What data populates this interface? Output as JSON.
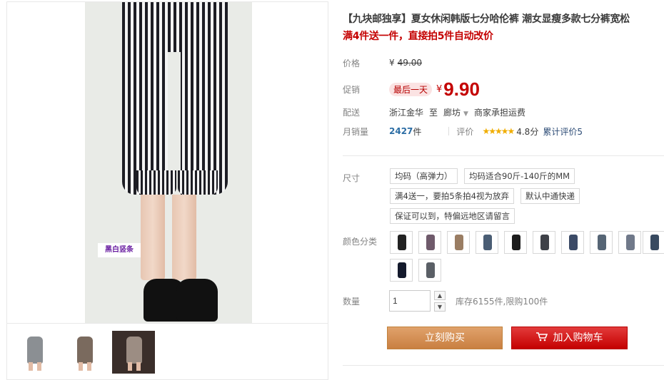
{
  "product": {
    "title": "【九块邮独享】夏女休闲韩版七分哈伦裤 潮女显瘦多款七分裤宽松",
    "subtitle": "满4件送一件，直接拍5件自动改价",
    "image_watermark": "黑白竖条"
  },
  "pricing": {
    "price_label": "价格",
    "currency": "¥",
    "original_price": "49.00",
    "promo_label": "促销",
    "promo_badge": "最后一天",
    "promo_price": "9.90"
  },
  "delivery": {
    "label": "配送",
    "from": "浙江金华",
    "to_word": "至",
    "destination": "廊坊",
    "shipping_note": "商家承担运费"
  },
  "sales": {
    "label": "月销量",
    "count": "2427",
    "unit": "件",
    "rating_label": "评价",
    "stars": "★★★★★",
    "score": "4.8分",
    "review_link": "累计评价5"
  },
  "options": {
    "size_label": "尺寸",
    "size_values": [
      "均码（高弹力）",
      "均码适合90斤-140斤的MM",
      "满4送一，要拍5条拍4视为放弃",
      "默认中通快递",
      "保证可以到，特偏远地区请留言"
    ],
    "color_label": "颜色分类"
  },
  "quantity": {
    "label": "数量",
    "value": "1",
    "stock_text": "库存6155件,限购100件"
  },
  "actions": {
    "buy_now": "立刻购买",
    "add_to_cart": "加入购物车"
  },
  "colors": {
    "promo_red": "#c40000",
    "buy_orange": "#c97f41",
    "link_blue": "#2d6ea5"
  }
}
